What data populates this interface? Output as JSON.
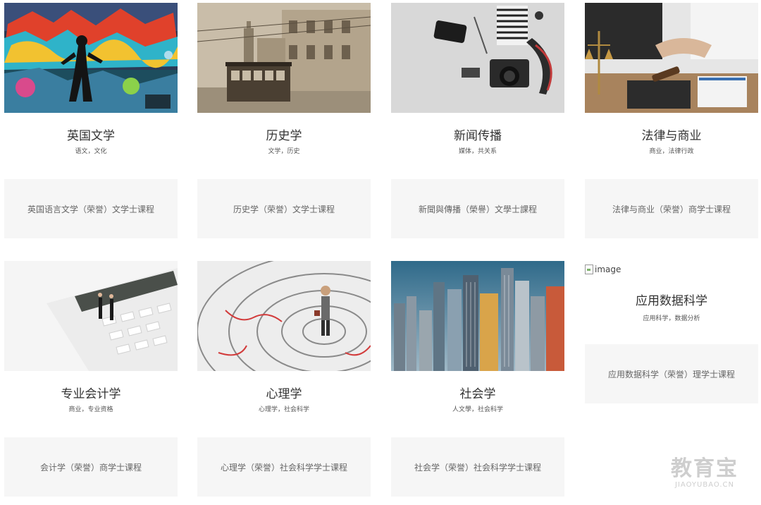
{
  "programs": [
    {
      "title": "英国文学",
      "tags": "语文，文化",
      "course": "英国语言文学（荣誉）文学士课程",
      "image": "graffiti-art"
    },
    {
      "title": "历史学",
      "tags": "文学，历史",
      "course": "历史学（荣誉）文学士课程",
      "image": "old-tram-street"
    },
    {
      "title": "新闻传播",
      "tags": "媒体，共关系",
      "course": "新聞與傳播（榮譽）文學士課程",
      "image": "camera-flatlay"
    },
    {
      "title": "法律与商业",
      "tags": "商业，法律行政",
      "course": "法律与商业（荣誉）商学士课程",
      "image": "handshake-gavel"
    },
    {
      "title": "专业会计学",
      "tags": "商业，专业资格",
      "course": "会计学（荣誉）商学士课程",
      "image": "calculator-businessmen"
    },
    {
      "title": "心理学",
      "tags": "心理学，社会科学",
      "course": "心理学（荣誉）社会科学学士课程",
      "image": "maze-man"
    },
    {
      "title": "社会学",
      "tags": "人文學，社会科学",
      "course": "社会学（荣誉）社会科学学士课程",
      "image": "city-skyline"
    },
    {
      "title": "应用数据科学",
      "tags": "应用科学，数据分析",
      "course": "应用数据科学（荣誉）理学士课程",
      "image_alt": "image"
    }
  ],
  "watermark": {
    "main": "教育宝",
    "sub": "JIAOYUBAO.CN"
  }
}
